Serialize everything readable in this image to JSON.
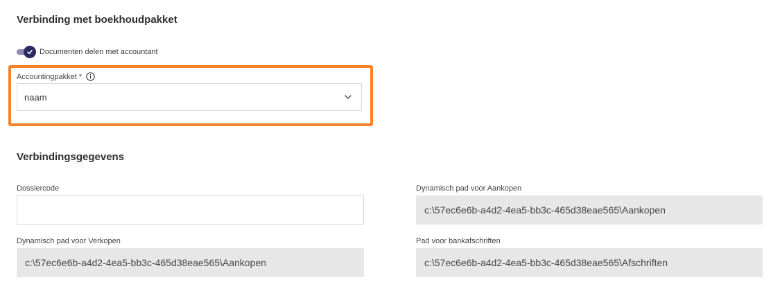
{
  "section1": {
    "title": "Verbinding met boekhoudpakket",
    "toggle": {
      "label": "Documenten delen met accountant",
      "checked": true,
      "color": "#2d2a63"
    },
    "accounting": {
      "label": "Accountingpakket *",
      "value": "naam",
      "info_icon": "info-icon",
      "highlight_color": "#f7822a"
    }
  },
  "section2": {
    "title": "Verbindingsgegevens",
    "dossiercode": {
      "label": "Dossiercode",
      "value": ""
    },
    "aankopen": {
      "label": "Dynamisch pad voor Aankopen",
      "value": "c:\\57ec6e6b-a4d2-4ea5-bb3c-465d38eae565\\Aankopen"
    },
    "verkopen": {
      "label": "Dynamisch pad voor Verkopen",
      "value": "c:\\57ec6e6b-a4d2-4ea5-bb3c-465d38eae565\\Aankopen"
    },
    "bank": {
      "label": "Pad voor bankafschriften",
      "value": "c:\\57ec6e6b-a4d2-4ea5-bb3c-465d38eae565\\Afschriften"
    }
  }
}
